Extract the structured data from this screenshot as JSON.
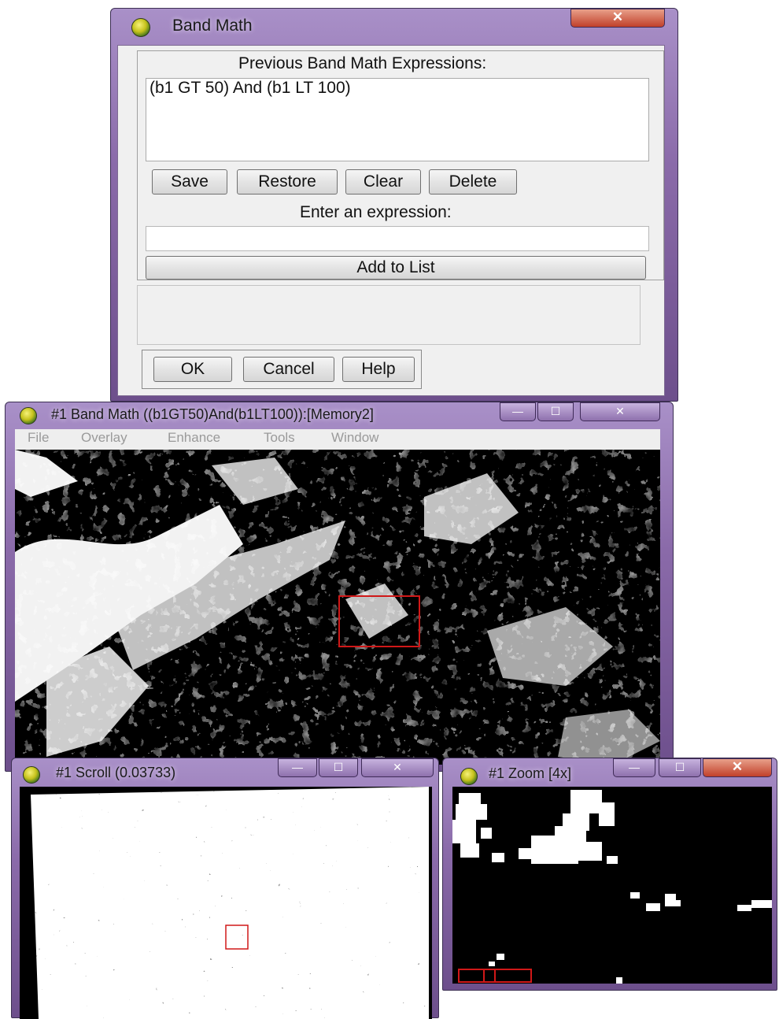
{
  "band_math": {
    "title": "Band Math",
    "close_glyph": "✕",
    "previous_label": "Previous Band Math Expressions:",
    "previous_expressions": [
      "(b1 GT 50) And (b1 LT 100)"
    ],
    "buttons": {
      "save": "Save",
      "restore": "Restore",
      "clear": "Clear",
      "delete": "Delete"
    },
    "enter_label": "Enter an expression:",
    "expression_value": "",
    "add_to_list": "Add to List",
    "ok": "OK",
    "cancel": "Cancel",
    "help": "Help"
  },
  "image_window": {
    "title": "#1 Band Math ((b1GT50)And(b1LT100)):[Memory2]",
    "menu": [
      "File",
      "Overlay",
      "Enhance",
      "Tools",
      "Window"
    ],
    "min_glyph": "—",
    "max_glyph": "☐",
    "close_glyph": "✕"
  },
  "scroll_window": {
    "title": "#1 Scroll (0.03733)",
    "min_glyph": "—",
    "max_glyph": "☐",
    "close_glyph": "✕"
  },
  "zoom_window": {
    "title": "#1 Zoom [4x]",
    "min_glyph": "—",
    "max_glyph": "☐",
    "close_glyph": "✕"
  },
  "colors": {
    "accent_purple": "#8a6aa9",
    "indicator_red": "#d01818",
    "dialog_bg": "#f0f0f0"
  }
}
